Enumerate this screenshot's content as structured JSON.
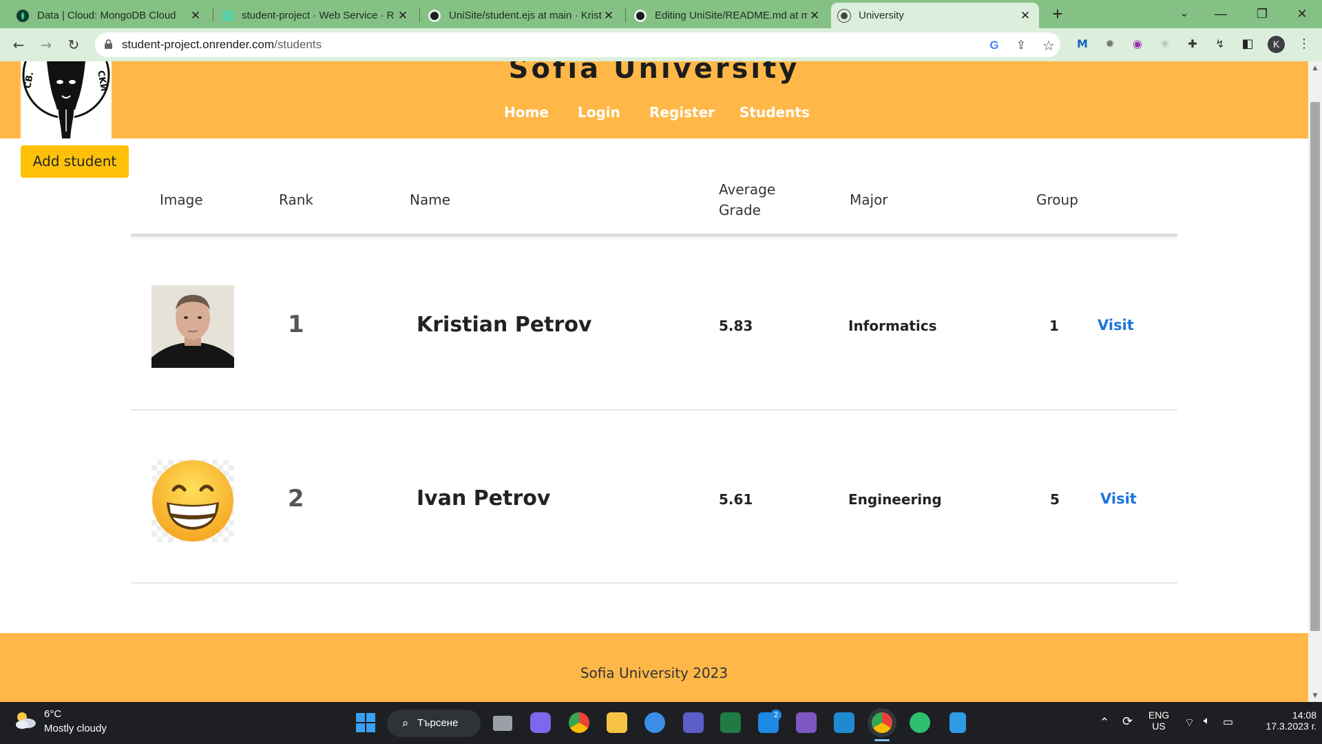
{
  "browser": {
    "tabs": [
      {
        "title": "Data | Cloud: MongoDB Cloud",
        "icon": "mongodb-leaf-icon"
      },
      {
        "title": "student-project · Web Service · R",
        "icon": "render-icon"
      },
      {
        "title": "UniSite/student.ejs at main · Krist",
        "icon": "github-icon"
      },
      {
        "title": "Editing UniSite/README.md at m",
        "icon": "github-icon"
      },
      {
        "title": "University",
        "icon": "globe-icon"
      }
    ],
    "url_host": "student-project.onrender.com",
    "url_path": "/students",
    "profile_initial": "K"
  },
  "site": {
    "title": "Sofia University",
    "nav": [
      "Home",
      "Login",
      "Register",
      "Students"
    ],
    "add_student_label": "Add student",
    "table_headers": {
      "image": "Image",
      "rank": "Rank",
      "name": "Name",
      "avg_line1": "Average",
      "avg_line2": "Grade",
      "major": "Major",
      "group": "Group"
    },
    "students": [
      {
        "rank": "1",
        "name": "Kristian Petrov",
        "grade": "5.83",
        "major": "Informatics",
        "group": "1",
        "action": "Visit",
        "image": "student-photo"
      },
      {
        "rank": "2",
        "name": "Ivan Petrov",
        "grade": "5.61",
        "major": "Engineering",
        "group": "5",
        "action": "Visit",
        "image": "grinning-emoji"
      }
    ],
    "footer": "Sofia University 2023"
  },
  "taskbar": {
    "temp": "6°C",
    "condition": "Mostly cloudy",
    "search_label": "Търсене",
    "mail_badge": "2",
    "lang_top": "ENG",
    "lang_bottom": "US",
    "time": "14:08",
    "date": "17.3.2023 г."
  },
  "colors": {
    "header": "#ffb848",
    "button": "#ffc107",
    "link": "#1a73d9",
    "browser_frame": "#85c185"
  }
}
